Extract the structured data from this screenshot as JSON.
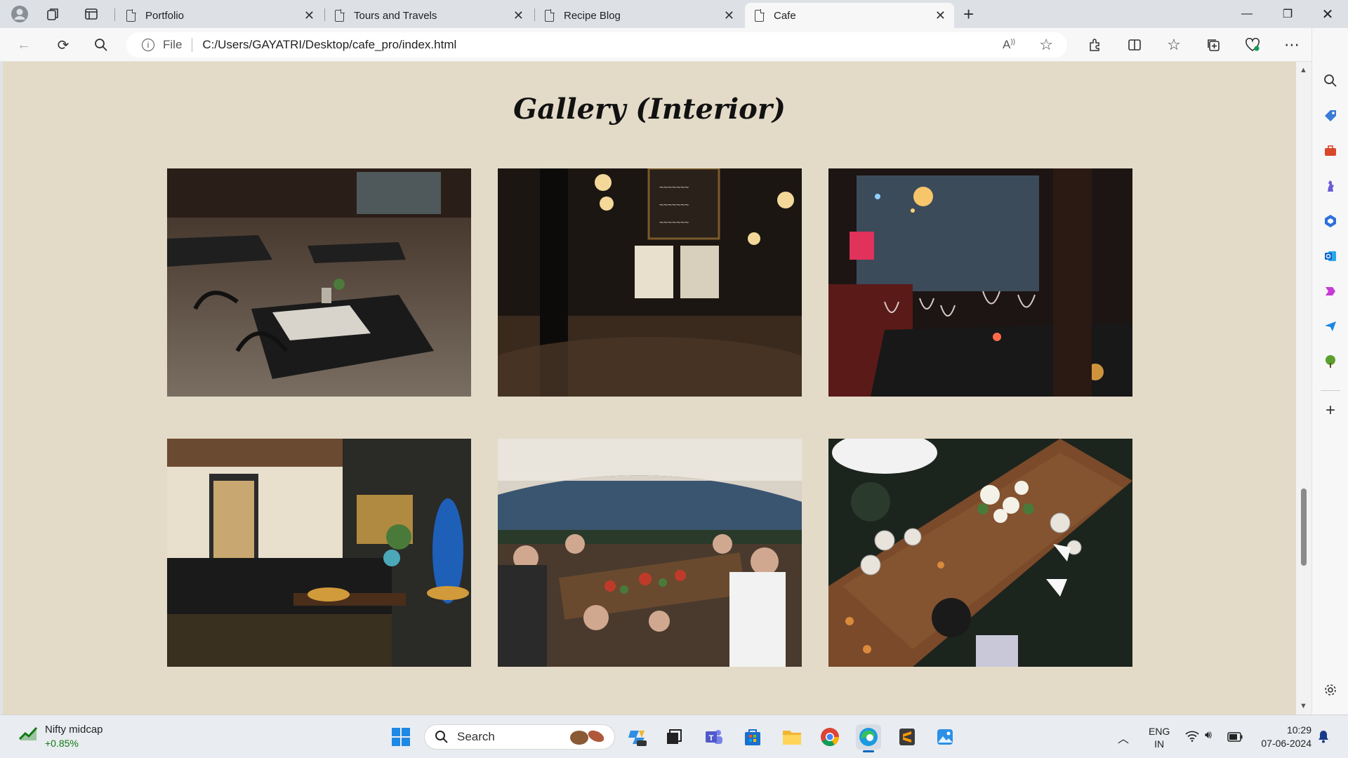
{
  "tabs": [
    {
      "label": "Portfolio",
      "active": false
    },
    {
      "label": "Tours and Travels",
      "active": false
    },
    {
      "label": "Recipe Blog",
      "active": false
    },
    {
      "label": "Cafe",
      "active": true
    }
  ],
  "address": {
    "scheme_label": "File",
    "url": "C:/Users/GAYATRI/Desktop/cafe_pro/index.html"
  },
  "page": {
    "title": "Gallery (Interior)"
  },
  "gallery": [
    {
      "name": "cafe-tables-photo"
    },
    {
      "name": "bar-interior-photo"
    },
    {
      "name": "wine-glasses-photo"
    },
    {
      "name": "coffee-counter-photo"
    },
    {
      "name": "tent-party-photo"
    },
    {
      "name": "overhead-table-photo"
    }
  ],
  "taskbar": {
    "widget_title": "Nifty midcap",
    "widget_value": "+0.85%",
    "search_placeholder": "Search",
    "lang_top": "ENG",
    "lang_bottom": "IN",
    "time": "10:29",
    "date": "07-06-2024"
  },
  "colors": {
    "page_bg": "#e3dbc8",
    "accent": "#0067c0",
    "widget_up": "#0f7b0f"
  }
}
